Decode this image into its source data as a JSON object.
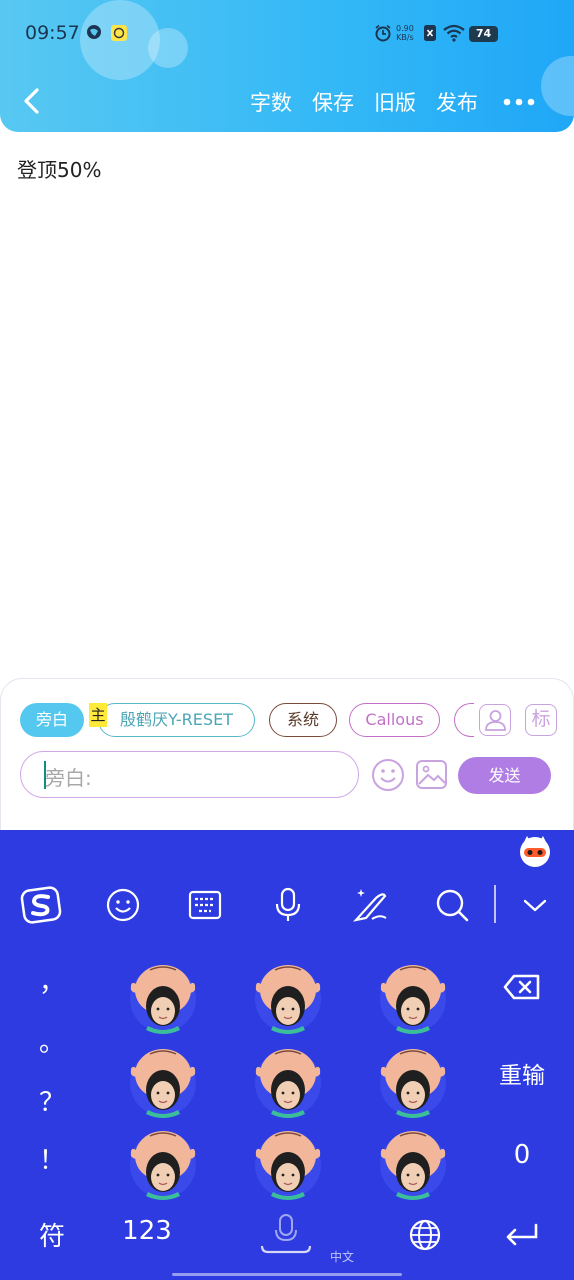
{
  "status_bar": {
    "time": "09:57",
    "net_speed_value": "0.90",
    "net_speed_unit": "KB/s",
    "battery": "74"
  },
  "header": {
    "back_icon": "chevron-left-icon",
    "buttons": [
      "字数",
      "保存",
      "旧版",
      "发布"
    ],
    "more_icon": "more-dots-icon"
  },
  "content": {
    "text": "登顶50%"
  },
  "input_panel": {
    "chips": {
      "narration": "旁白",
      "main_tag": "主",
      "character_1": "殷鹤厌Y-RESET",
      "character_2": "系统",
      "character_3": "Callous"
    },
    "side_buttons": {
      "person_icon": "person-icon",
      "tag_label": "标"
    },
    "input": {
      "placeholder": "旁白:"
    },
    "send": "发送",
    "icons": [
      "smiley-icon",
      "image-icon"
    ]
  },
  "keyboard": {
    "toolbar_icons": [
      "sogou-logo-icon",
      "emoji-icon",
      "keyboard-icon",
      "microphone-icon",
      "handwriting-icon",
      "search-icon",
      "collapse-icon"
    ],
    "punctuation": [
      "，",
      "。",
      "？",
      "！"
    ],
    "right_keys": {
      "backspace_icon": "backspace-icon",
      "retype": "重输",
      "zero": "0"
    },
    "bottom_row": {
      "symbols": "符",
      "numbers": "123",
      "language_label": "中文",
      "globe_icon": "globe-icon",
      "enter_icon": "enter-icon"
    },
    "colors": {
      "background": "#2d3be0",
      "send_button": "#b07de4",
      "header_gradient_start": "#58c8f2",
      "header_gradient_end": "#1fa7f7"
    }
  }
}
